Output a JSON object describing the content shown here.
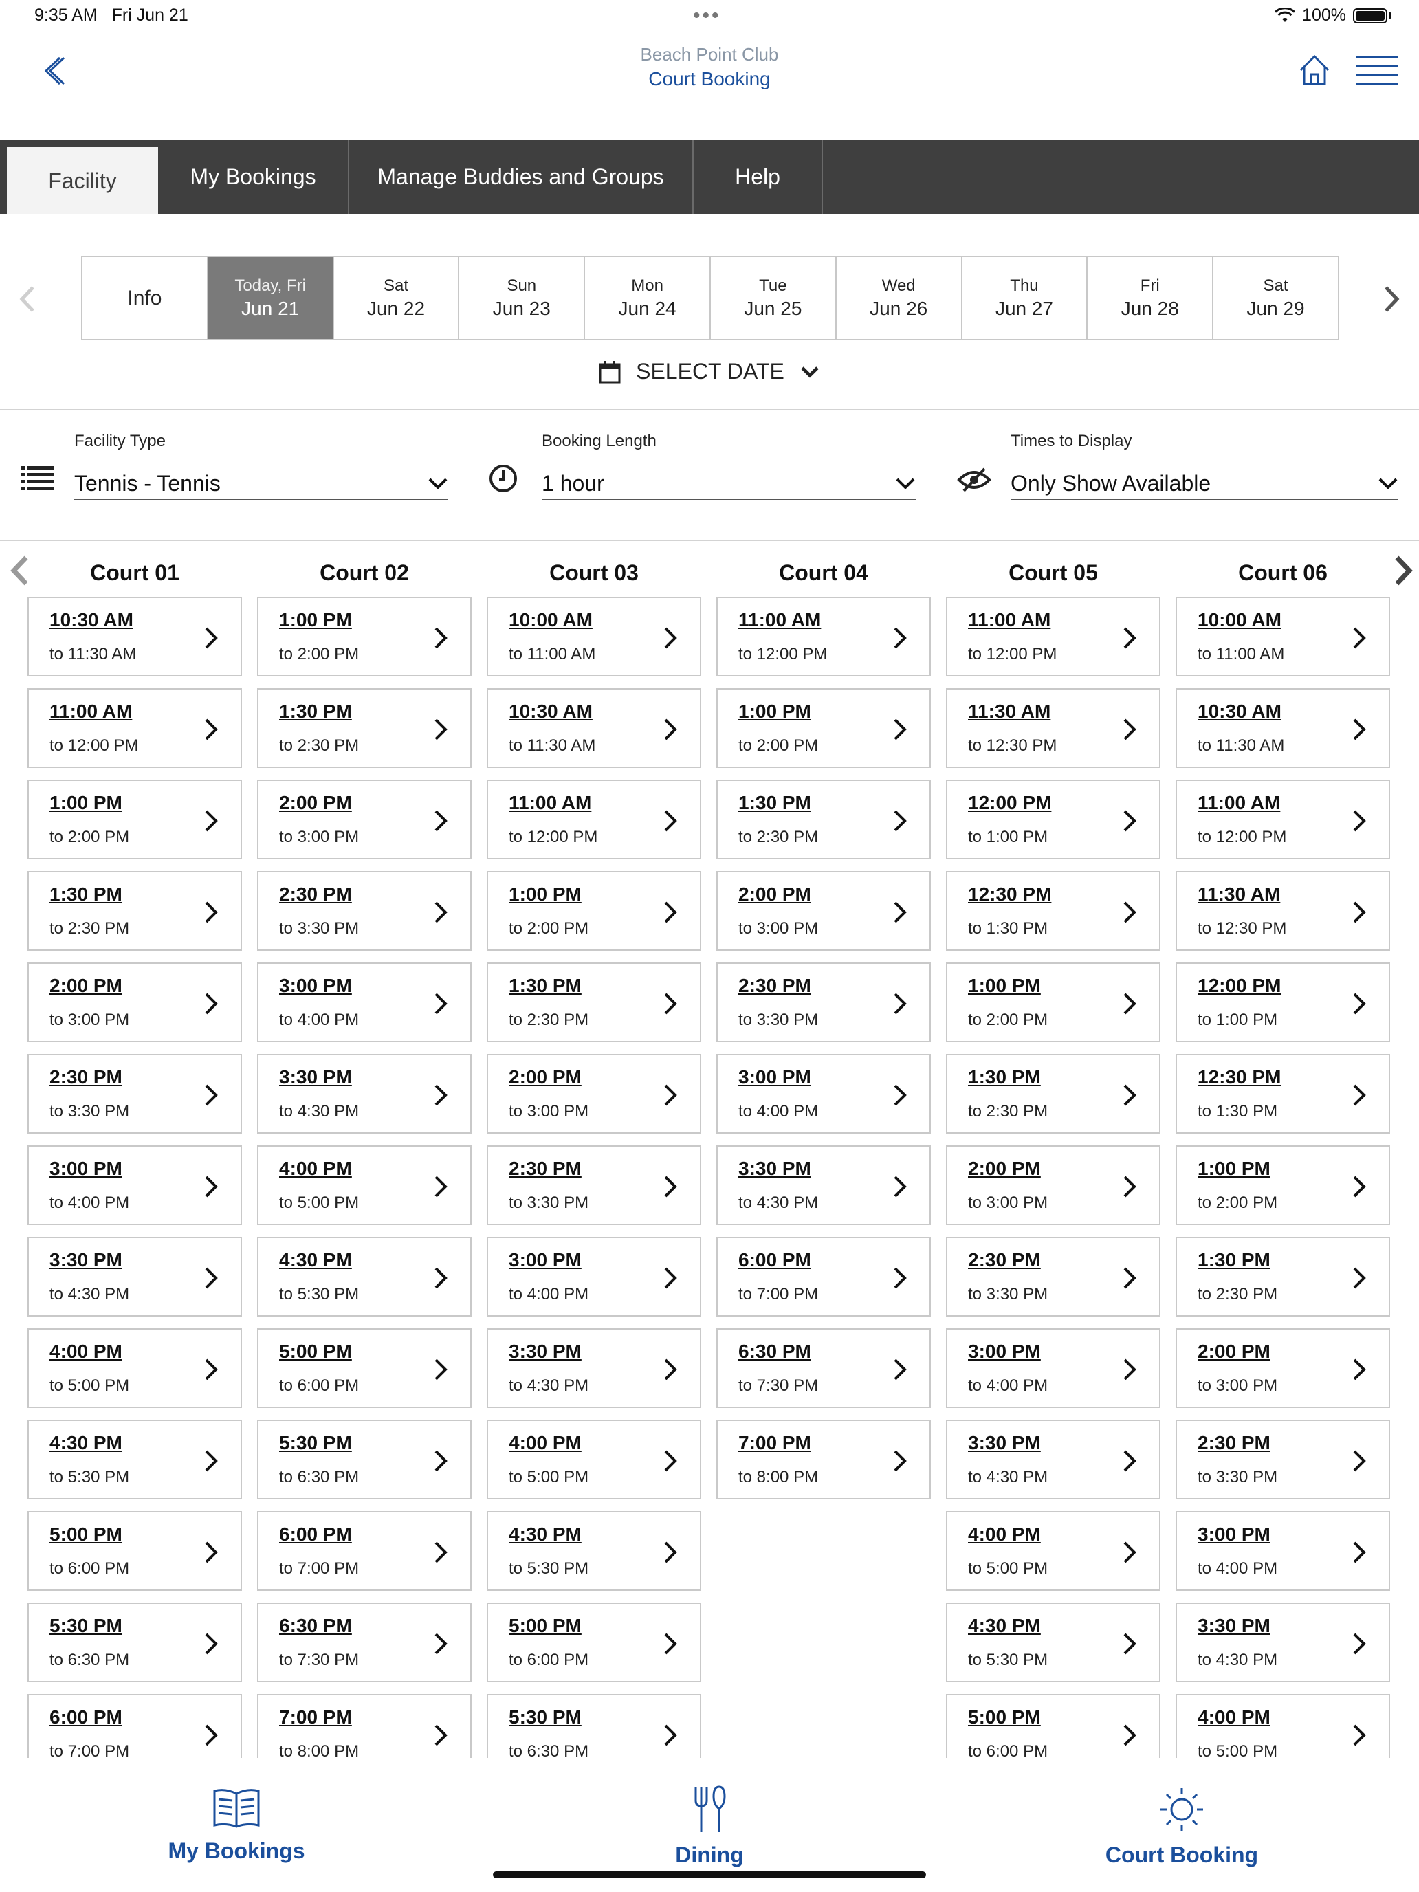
{
  "status_bar": {
    "time": "9:35 AM",
    "date": "Fri Jun 21",
    "battery": "100%"
  },
  "header": {
    "club_name": "Beach Point Club",
    "page_title": "Court Booking"
  },
  "tabs": [
    {
      "label": "Facility",
      "active": true
    },
    {
      "label": "My Bookings"
    },
    {
      "label": "Manage Buddies and Groups"
    },
    {
      "label": "Help"
    }
  ],
  "date_strip": {
    "info_label": "Info",
    "days": [
      {
        "dow": "Today, Fri",
        "date": "Jun 21",
        "selected": true
      },
      {
        "dow": "Sat",
        "date": "Jun 22"
      },
      {
        "dow": "Sun",
        "date": "Jun 23"
      },
      {
        "dow": "Mon",
        "date": "Jun 24"
      },
      {
        "dow": "Tue",
        "date": "Jun 25"
      },
      {
        "dow": "Wed",
        "date": "Jun 26"
      },
      {
        "dow": "Thu",
        "date": "Jun 27"
      },
      {
        "dow": "Fri",
        "date": "Jun 28"
      },
      {
        "dow": "Sat",
        "date": "Jun 29"
      }
    ],
    "select_date_label": "SELECT DATE"
  },
  "filters": {
    "facility_type": {
      "label": "Facility Type",
      "value": "Tennis - Tennis"
    },
    "booking_length": {
      "label": "Booking Length",
      "value": "1 hour"
    },
    "times_to_display": {
      "label": "Times to Display",
      "value": "Only Show Available"
    }
  },
  "courts": [
    {
      "name": "Court 01",
      "slots": [
        [
          "10:30 AM",
          "to 11:30 AM"
        ],
        [
          "11:00 AM",
          "to 12:00 PM"
        ],
        [
          "1:00 PM",
          "to 2:00 PM"
        ],
        [
          "1:30 PM",
          "to 2:30 PM"
        ],
        [
          "2:00 PM",
          "to 3:00 PM"
        ],
        [
          "2:30 PM",
          "to 3:30 PM"
        ],
        [
          "3:00 PM",
          "to 4:00 PM"
        ],
        [
          "3:30 PM",
          "to 4:30 PM"
        ],
        [
          "4:00 PM",
          "to 5:00 PM"
        ],
        [
          "4:30 PM",
          "to 5:30 PM"
        ],
        [
          "5:00 PM",
          "to 6:00 PM"
        ],
        [
          "5:30 PM",
          "to 6:30 PM"
        ],
        [
          "6:00 PM",
          "to 7:00 PM"
        ]
      ]
    },
    {
      "name": "Court 02",
      "slots": [
        [
          "1:00 PM",
          "to 2:00 PM"
        ],
        [
          "1:30 PM",
          "to 2:30 PM"
        ],
        [
          "2:00 PM",
          "to 3:00 PM"
        ],
        [
          "2:30 PM",
          "to 3:30 PM"
        ],
        [
          "3:00 PM",
          "to 4:00 PM"
        ],
        [
          "3:30 PM",
          "to 4:30 PM"
        ],
        [
          "4:00 PM",
          "to 5:00 PM"
        ],
        [
          "4:30 PM",
          "to 5:30 PM"
        ],
        [
          "5:00 PM",
          "to 6:00 PM"
        ],
        [
          "5:30 PM",
          "to 6:30 PM"
        ],
        [
          "6:00 PM",
          "to 7:00 PM"
        ],
        [
          "6:30 PM",
          "to 7:30 PM"
        ],
        [
          "7:00 PM",
          "to 8:00 PM"
        ]
      ]
    },
    {
      "name": "Court 03",
      "slots": [
        [
          "10:00 AM",
          "to 11:00 AM"
        ],
        [
          "10:30 AM",
          "to 11:30 AM"
        ],
        [
          "11:00 AM",
          "to 12:00 PM"
        ],
        [
          "1:00 PM",
          "to 2:00 PM"
        ],
        [
          "1:30 PM",
          "to 2:30 PM"
        ],
        [
          "2:00 PM",
          "to 3:00 PM"
        ],
        [
          "2:30 PM",
          "to 3:30 PM"
        ],
        [
          "3:00 PM",
          "to 4:00 PM"
        ],
        [
          "3:30 PM",
          "to 4:30 PM"
        ],
        [
          "4:00 PM",
          "to 5:00 PM"
        ],
        [
          "4:30 PM",
          "to 5:30 PM"
        ],
        [
          "5:00 PM",
          "to 6:00 PM"
        ],
        [
          "5:30 PM",
          "to 6:30 PM"
        ]
      ]
    },
    {
      "name": "Court 04",
      "slots": [
        [
          "11:00 AM",
          "to 12:00 PM"
        ],
        [
          "1:00 PM",
          "to 2:00 PM"
        ],
        [
          "1:30 PM",
          "to 2:30 PM"
        ],
        [
          "2:00 PM",
          "to 3:00 PM"
        ],
        [
          "2:30 PM",
          "to 3:30 PM"
        ],
        [
          "3:00 PM",
          "to 4:00 PM"
        ],
        [
          "3:30 PM",
          "to 4:30 PM"
        ],
        [
          "6:00 PM",
          "to 7:00 PM"
        ],
        [
          "6:30 PM",
          "to 7:30 PM"
        ],
        [
          "7:00 PM",
          "to 8:00 PM"
        ]
      ]
    },
    {
      "name": "Court 05",
      "slots": [
        [
          "11:00 AM",
          "to 12:00 PM"
        ],
        [
          "11:30 AM",
          "to 12:30 PM"
        ],
        [
          "12:00 PM",
          "to 1:00 PM"
        ],
        [
          "12:30 PM",
          "to 1:30 PM"
        ],
        [
          "1:00 PM",
          "to 2:00 PM"
        ],
        [
          "1:30 PM",
          "to 2:30 PM"
        ],
        [
          "2:00 PM",
          "to 3:00 PM"
        ],
        [
          "2:30 PM",
          "to 3:30 PM"
        ],
        [
          "3:00 PM",
          "to 4:00 PM"
        ],
        [
          "3:30 PM",
          "to 4:30 PM"
        ],
        [
          "4:00 PM",
          "to 5:00 PM"
        ],
        [
          "4:30 PM",
          "to 5:30 PM"
        ],
        [
          "5:00 PM",
          "to 6:00 PM"
        ]
      ]
    },
    {
      "name": "Court 06",
      "slots": [
        [
          "10:00 AM",
          "to 11:00 AM"
        ],
        [
          "10:30 AM",
          "to 11:30 AM"
        ],
        [
          "11:00 AM",
          "to 12:00 PM"
        ],
        [
          "11:30 AM",
          "to 12:30 PM"
        ],
        [
          "12:00 PM",
          "to 1:00 PM"
        ],
        [
          "12:30 PM",
          "to 1:30 PM"
        ],
        [
          "1:00 PM",
          "to 2:00 PM"
        ],
        [
          "1:30 PM",
          "to 2:30 PM"
        ],
        [
          "2:00 PM",
          "to 3:00 PM"
        ],
        [
          "2:30 PM",
          "to 3:30 PM"
        ],
        [
          "3:00 PM",
          "to 4:00 PM"
        ],
        [
          "3:30 PM",
          "to 4:30 PM"
        ],
        [
          "4:00 PM",
          "to 5:00 PM"
        ]
      ]
    }
  ],
  "bottom_nav": [
    {
      "label": "My Bookings",
      "icon": "book-icon"
    },
    {
      "label": "Dining",
      "icon": "fork-knife-icon"
    },
    {
      "label": "Court Booking",
      "icon": "sun-icon"
    }
  ],
  "colors": {
    "brand_blue": "#1b4f9c",
    "tabbar_bg": "#3f3f3f",
    "selected_day_bg": "#7a7a7a"
  }
}
